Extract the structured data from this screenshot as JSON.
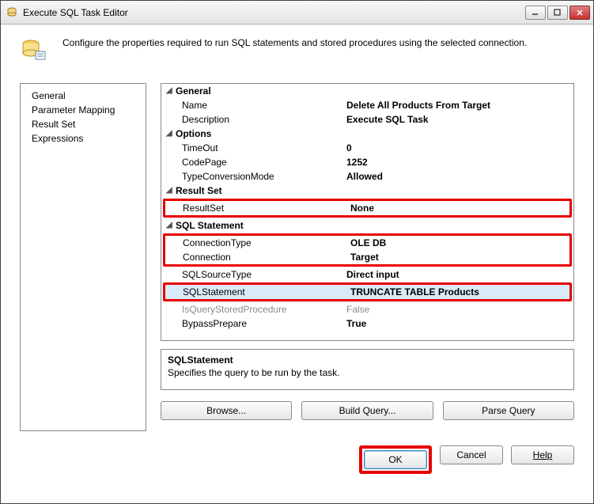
{
  "window": {
    "title": "Execute SQL Task Editor"
  },
  "header": {
    "description": "Configure the properties required to run SQL statements and stored procedures using the selected connection."
  },
  "sidebar": {
    "items": [
      {
        "label": "General",
        "selected": true
      },
      {
        "label": "Parameter Mapping",
        "selected": false
      },
      {
        "label": "Result Set",
        "selected": false
      },
      {
        "label": "Expressions",
        "selected": false
      }
    ]
  },
  "propertyGrid": {
    "groups": [
      {
        "name": "General",
        "rows": [
          {
            "label": "Name",
            "value": "Delete All Products From Target",
            "bold": true
          },
          {
            "label": "Description",
            "value": "Execute SQL Task",
            "bold": true
          }
        ]
      },
      {
        "name": "Options",
        "rows": [
          {
            "label": "TimeOut",
            "value": "0",
            "bold": true
          },
          {
            "label": "CodePage",
            "value": "1252",
            "bold": true
          },
          {
            "label": "TypeConversionMode",
            "value": "Allowed",
            "bold": true
          }
        ]
      },
      {
        "name": "Result Set",
        "rows": [
          {
            "label": "ResultSet",
            "value": "None",
            "bold": true,
            "highlighted": true
          }
        ]
      },
      {
        "name": "SQL Statement",
        "rows": [
          {
            "label": "ConnectionType",
            "value": "OLE DB",
            "bold": true,
            "highlighted": "group1"
          },
          {
            "label": "Connection",
            "value": "Target",
            "bold": true,
            "highlighted": "group1"
          },
          {
            "label": "SQLSourceType",
            "value": "Direct input",
            "bold": true
          },
          {
            "label": "SQLStatement",
            "value": "TRUNCATE TABLE Products",
            "bold": true,
            "highlighted": true,
            "selected": true
          },
          {
            "label": "IsQueryStoredProcedure",
            "value": "False",
            "disabled": true
          },
          {
            "label": "BypassPrepare",
            "value": "True",
            "bold": true
          }
        ]
      }
    ]
  },
  "descPanel": {
    "title": "SQLStatement",
    "text": "Specifies the query to be run by the task."
  },
  "midButtons": {
    "browse": "Browse...",
    "buildQuery": "Build Query...",
    "parseQuery": "Parse Query"
  },
  "footer": {
    "ok": "OK",
    "cancel": "Cancel",
    "help": "Help"
  }
}
